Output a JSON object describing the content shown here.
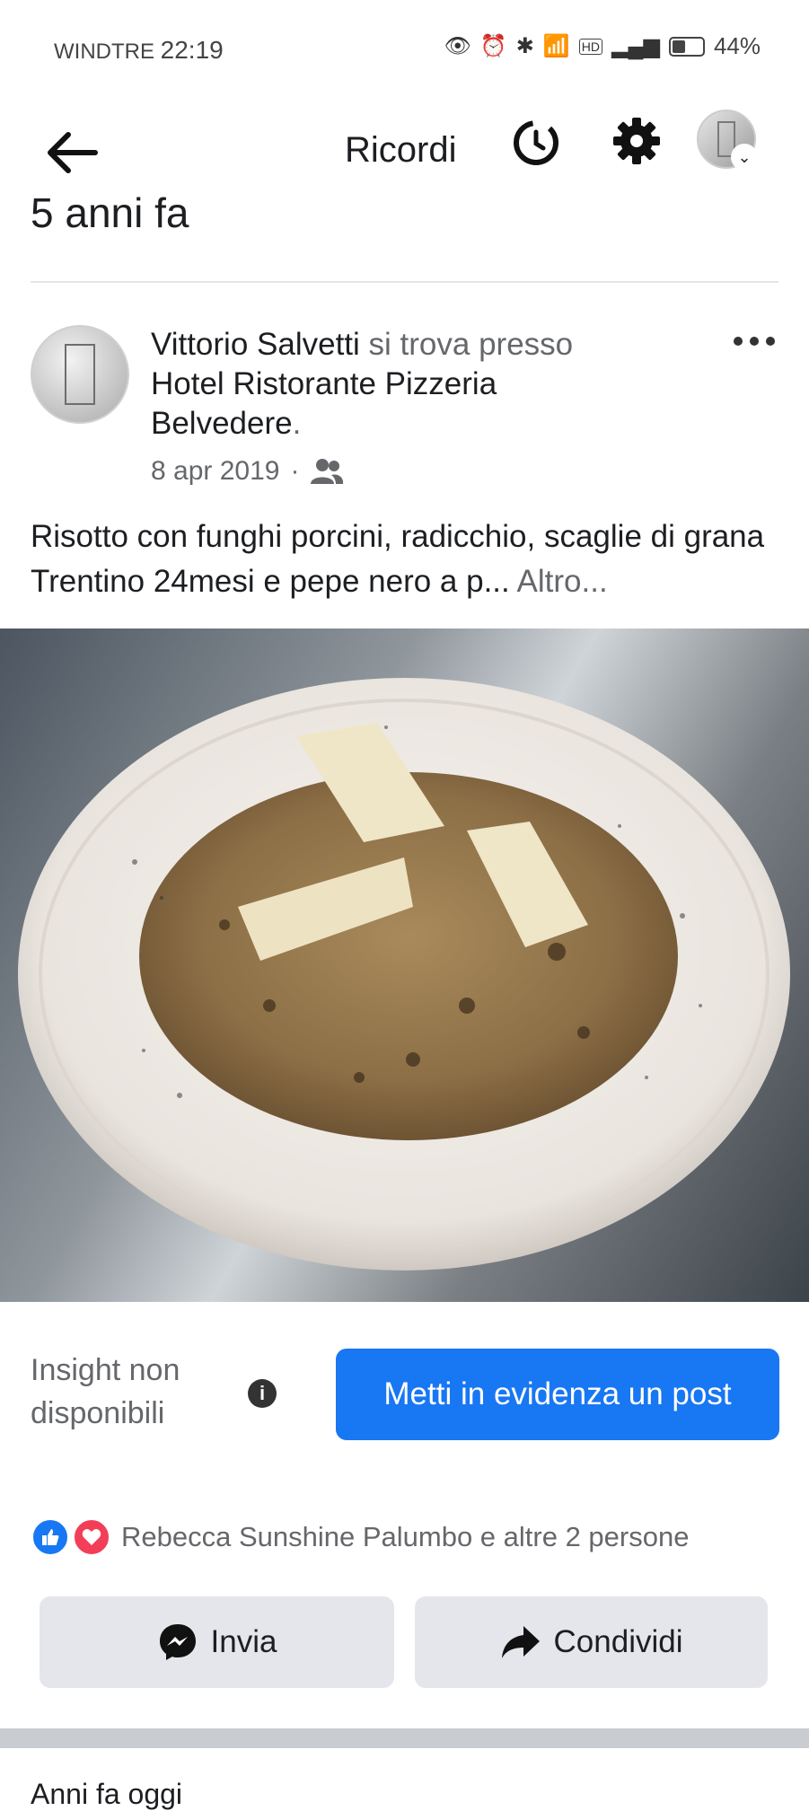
{
  "status_bar": {
    "carrier": "WINDTRE",
    "time": "22:19",
    "network": "HD",
    "battery": "44%",
    "battery_level": 0.44
  },
  "header": {
    "title": "Ricordi"
  },
  "memories": {
    "years_ago": "5 anni fa"
  },
  "post": {
    "author": "Vittorio Salvetti",
    "connector": "si trova presso",
    "place": "Hotel Ristorante Pizzeria Belvedere",
    "place_suffix": ".",
    "date": "8 apr 2019",
    "date_separator": "·",
    "audience_icon": "friends-icon",
    "text": "Risotto con funghi porcini, radicchio, scaglie di grana Trentino 24mesi e pepe nero a p...",
    "more_label": "Altro...",
    "photo_description_icon": "risotto-photo"
  },
  "insights": {
    "label": "Insight non disponibili",
    "boost_label": "Metti in evidenza un post"
  },
  "reactions": {
    "text": "Rebecca Sunshine Palumbo e altre 2 persone"
  },
  "actions": {
    "send_label": "Invia",
    "share_label": "Condividi"
  },
  "next_item": {
    "text": "Anni fa oggi"
  },
  "colors": {
    "accent": "#1877f2",
    "love": "#f33e58",
    "button_bg": "#e4e6eb",
    "secondary_text": "#65676b"
  }
}
